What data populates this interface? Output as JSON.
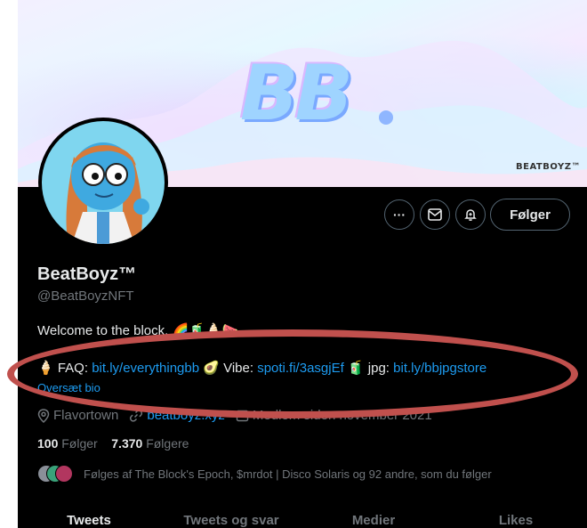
{
  "banner": {
    "logo_text": "BB",
    "brand_tag": "BEATBOYZ™"
  },
  "profile": {
    "name": "BeatBoyz™",
    "handle": "@BeatBoyzNFT",
    "bio_line1": "Welcome to the block. 🌈🧃🍦🍉",
    "bio_line2": {
      "faq_prefix": "🍦 FAQ: ",
      "faq_link": "bit.ly/everythingbb",
      "vibe_prefix": " 🥑 Vibe: ",
      "vibe_link": "spoti.fi/3asgjEf",
      "jpg_prefix": " 🧃 jpg: ",
      "jpg_link": "bit.ly/bbjpgstore"
    },
    "translate_label": "Oversæt bio",
    "location": "Flavortown",
    "website": "beatboyz.xyz",
    "joined": "Medlem siden november 2021",
    "following_count": "100",
    "following_label": "Følger",
    "followers_count": "7.370",
    "followers_label": "Følgere",
    "followed_by": "Følges af The Block's Epoch, $mrdot | Disco Solaris og 92 andre, som du følger"
  },
  "actions": {
    "more_label": "···",
    "follow_label": "Følger"
  },
  "tabs": [
    {
      "label": "Tweets",
      "active": true
    },
    {
      "label": "Tweets og svar",
      "active": false
    },
    {
      "label": "Medier",
      "active": false
    },
    {
      "label": "Likes",
      "active": false
    }
  ],
  "colors": {
    "background": "#000000",
    "link": "#1d9bf0",
    "text": "#e7e9ea",
    "muted": "#71767b",
    "annotation": "#c0504d"
  }
}
